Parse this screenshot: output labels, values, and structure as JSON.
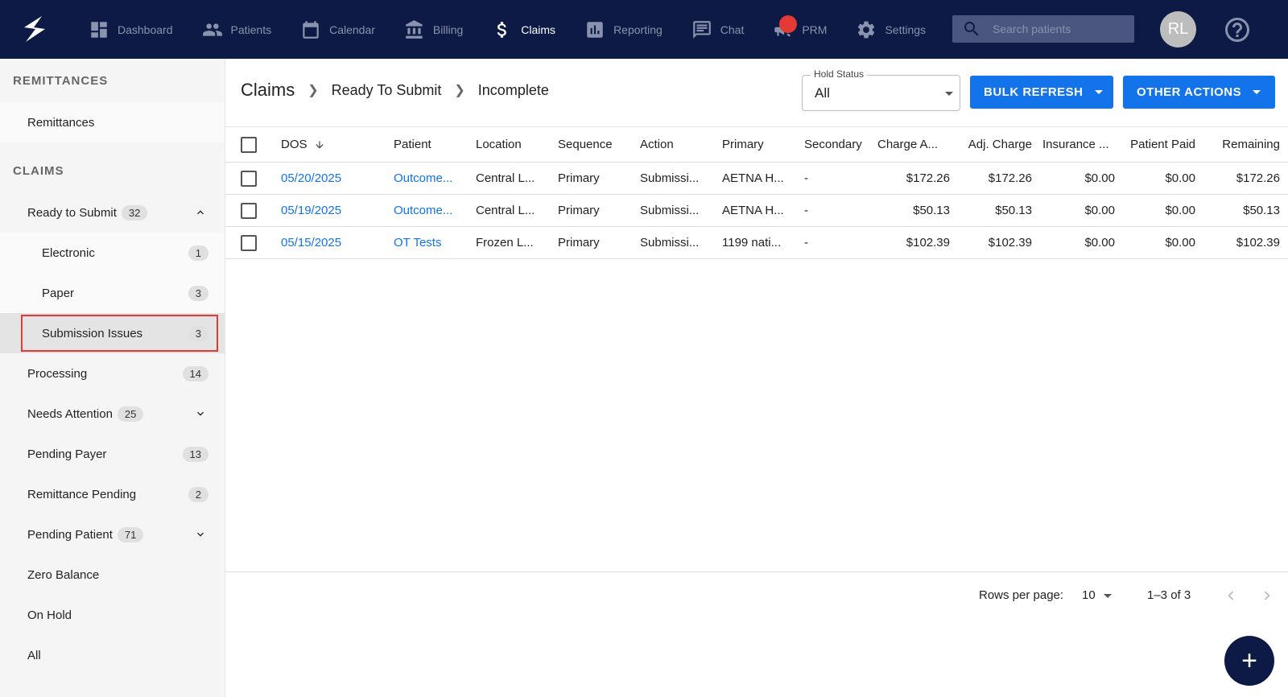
{
  "nav": {
    "items": [
      {
        "label": "Dashboard",
        "icon": "dashboard-icon"
      },
      {
        "label": "Patients",
        "icon": "people-icon"
      },
      {
        "label": "Calendar",
        "icon": "calendar-icon"
      },
      {
        "label": "Billing",
        "icon": "bank-icon"
      },
      {
        "label": "Claims",
        "icon": "dollar-icon"
      },
      {
        "label": "Reporting",
        "icon": "chart-icon"
      },
      {
        "label": "Chat",
        "icon": "chat-icon"
      },
      {
        "label": "PRM",
        "icon": "megaphone-icon"
      },
      {
        "label": "Settings",
        "icon": "gear-icon"
      }
    ],
    "active": "Claims",
    "search_placeholder": "Search patients",
    "avatar_initials": "RL"
  },
  "sidebar": {
    "remittances_header": "REMITTANCES",
    "remittances_item": "Remittances",
    "claims_header": "CLAIMS",
    "items": [
      {
        "label": "Ready to Submit",
        "count": "32"
      },
      {
        "label": "Electronic",
        "count": "1"
      },
      {
        "label": "Paper",
        "count": "3"
      },
      {
        "label": "Submission Issues",
        "count": "3"
      },
      {
        "label": "Processing",
        "count": "14"
      },
      {
        "label": "Needs Attention",
        "count": "25"
      },
      {
        "label": "Pending Payer",
        "count": "13"
      },
      {
        "label": "Remittance Pending",
        "count": "2"
      },
      {
        "label": "Pending Patient",
        "count": "71"
      },
      {
        "label": "Zero Balance",
        "count": ""
      },
      {
        "label": "On Hold",
        "count": ""
      },
      {
        "label": "All",
        "count": ""
      }
    ]
  },
  "breadcrumb": {
    "title": "Claims",
    "level1": "Ready To Submit",
    "level2": "Incomplete"
  },
  "hold_status": {
    "label": "Hold Status",
    "value": "All"
  },
  "buttons": {
    "bulk_refresh": "BULK REFRESH",
    "other_actions": "OTHER ACTIONS"
  },
  "table": {
    "columns": [
      "DOS",
      "Patient",
      "Location",
      "Sequence",
      "Action",
      "Primary",
      "Secondary",
      "Charge A...",
      "Adj. Charge",
      "Insurance ...",
      "Patient Paid",
      "Remaining"
    ],
    "rows": [
      [
        "05/20/2025",
        "Outcome...",
        "Central L...",
        "Primary",
        "Submissi...",
        "AETNA H...",
        "-",
        "$172.26",
        "$172.26",
        "$0.00",
        "$0.00",
        "$172.26"
      ],
      [
        "05/19/2025",
        "Outcome...",
        "Central L...",
        "Primary",
        "Submissi...",
        "AETNA H...",
        "-",
        "$50.13",
        "$50.13",
        "$0.00",
        "$0.00",
        "$50.13"
      ],
      [
        "05/15/2025",
        "OT Tests",
        "Frozen L...",
        "Primary",
        "Submissi...",
        "1199 nati...",
        "-",
        "$102.39",
        "$102.39",
        "$0.00",
        "$0.00",
        "$102.39"
      ]
    ]
  },
  "pagination": {
    "rows_per_page_label": "Rows per page:",
    "rows_per_page": "10",
    "range": "1–3 of 3"
  },
  "fab_label": "+"
}
